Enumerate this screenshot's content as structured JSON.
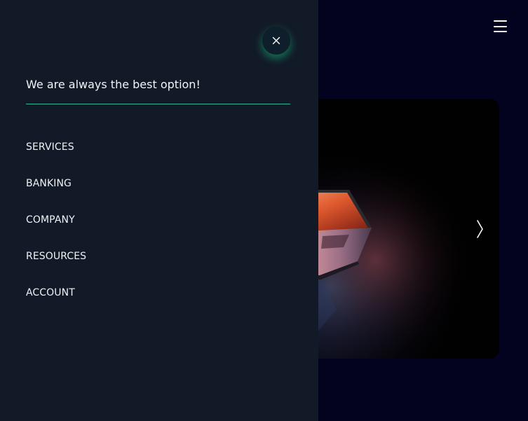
{
  "header": {
    "menu_icon": "hamburger-menu-icon"
  },
  "drawer": {
    "close_icon": "close-icon",
    "tagline": "We are always the best option!",
    "items": [
      {
        "label": "SERVICES"
      },
      {
        "label": "BANKING"
      },
      {
        "label": "COMPANY"
      },
      {
        "label": "RESOURCES"
      },
      {
        "label": "ACCOUNT"
      }
    ]
  },
  "hero": {
    "image_subject": "laptop-photo",
    "next_icon": "chevron-right-icon"
  },
  "colors": {
    "page_bg": "#03021f",
    "drawer_bg": "#121a27",
    "accent": "#2fb597",
    "close_glow": "#20d696"
  }
}
